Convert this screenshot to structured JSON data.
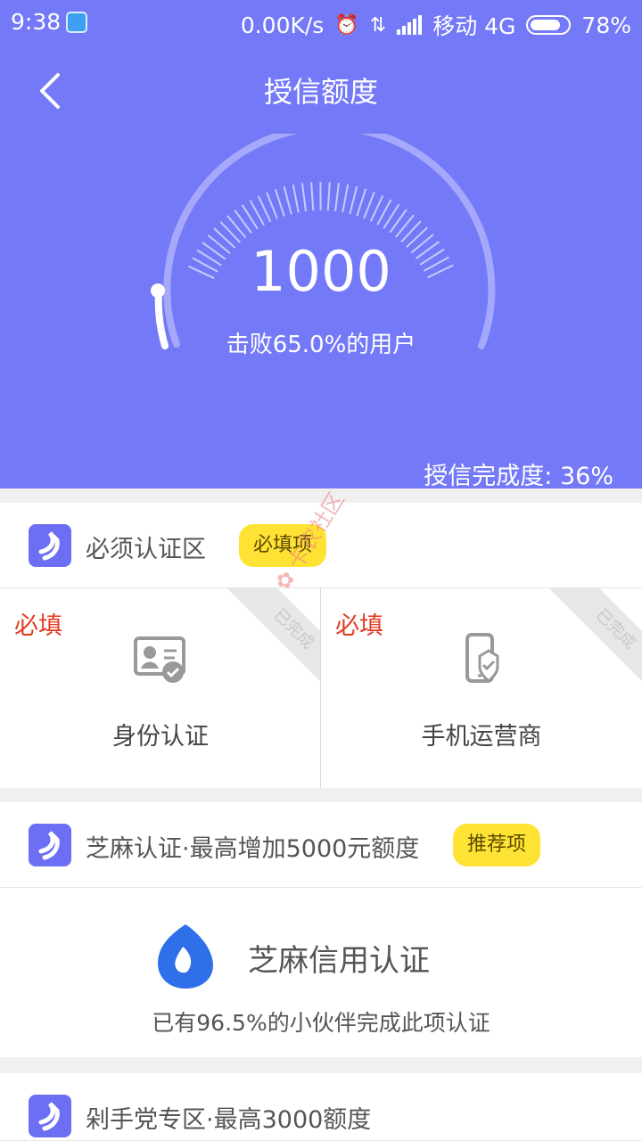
{
  "status": {
    "time": "9:38",
    "network_speed": "0.00K/s",
    "carrier": "移动 4G",
    "battery": "78%",
    "icons": [
      "alarm-icon",
      "data-transfer-icon",
      "signal-icon",
      "battery-icon"
    ]
  },
  "header": {
    "title": "授信额度"
  },
  "credit": {
    "score": "1000",
    "beat_text": "击败65.0%的用户",
    "completion_text": "授信完成度: 36%",
    "completion_value": 36
  },
  "required_section": {
    "title": "必须认证区",
    "tag": "必填项",
    "cards": [
      {
        "required": "必填",
        "label": "身份认证",
        "ribbon": "已完成",
        "icon": "id-card-icon"
      },
      {
        "required": "必填",
        "label": "手机运营商",
        "ribbon": "已完成",
        "icon": "phone-verified-icon"
      }
    ]
  },
  "zhima_section": {
    "title": "芝麻认证·最高增加5000元额度",
    "tag": "推荐项",
    "card_title": "芝麻信用认证",
    "card_subtitle": "已有96.5%的小伙伴完成此项认证",
    "icon": "sesame-drop-icon"
  },
  "hand_section": {
    "title": "剁手党专区·最高3000额度"
  },
  "watermark": {
    "text": "卡农社区"
  },
  "colors": {
    "hero": "#7479f7",
    "tag": "#ffe334",
    "required": "#e23b22",
    "zhima": "#2f6fe9"
  }
}
